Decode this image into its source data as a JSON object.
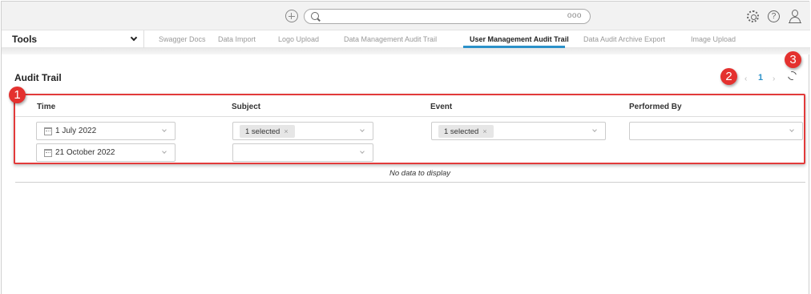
{
  "topbar": {
    "search": {
      "placeholder": "",
      "more": "ooo"
    },
    "help": "?"
  },
  "toolbar": {
    "tools_label": "Tools",
    "tabs": [
      {
        "label": "Swagger Docs"
      },
      {
        "label": "Data Import"
      },
      {
        "label": "Logo Upload"
      },
      {
        "label": "Data Management Audit Trail"
      },
      {
        "label": "User Management Audit Trail",
        "active": true
      },
      {
        "label": "Data Audit Archive Export"
      },
      {
        "label": "Image Upload"
      }
    ]
  },
  "audit": {
    "title": "Audit Trail",
    "pager": {
      "prev": "‹",
      "page": "1",
      "next": "›"
    },
    "columns": [
      "Time",
      "Subject",
      "Event",
      "Performed By"
    ],
    "filters": {
      "time_start": "1 July 2022",
      "time_end": "21 October 2022",
      "subject_tag": "1 selected",
      "event_tag": "1 selected",
      "remove": "×"
    },
    "empty_text": "No data to display"
  },
  "callouts": [
    "1",
    "2",
    "3"
  ],
  "colors": {
    "accent": "#2b91c9",
    "callout": "#e4312f",
    "highlight": "#e23a3a"
  }
}
